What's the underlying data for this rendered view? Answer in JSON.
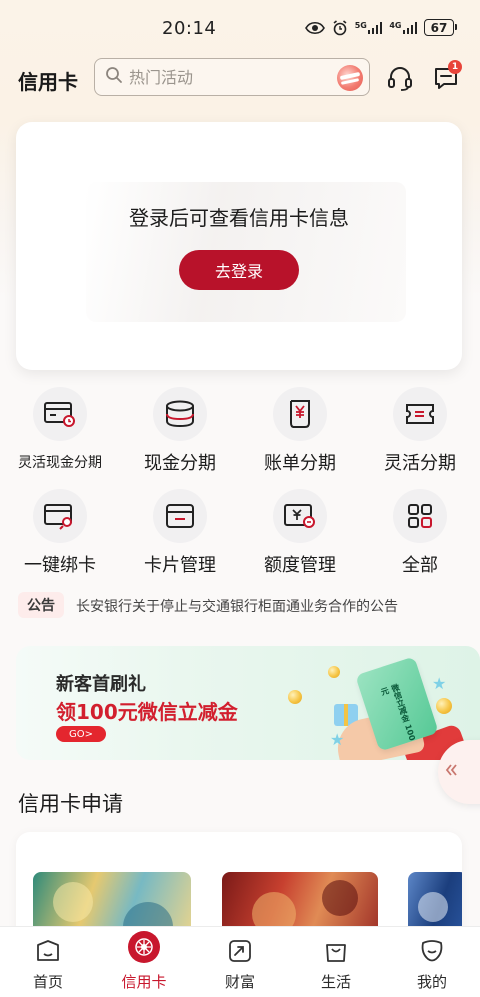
{
  "status_bar": {
    "time": "20:14",
    "net_5g": "5G",
    "net_4g": "4G",
    "battery": "67"
  },
  "header": {
    "title": "信用卡",
    "search_placeholder": "热门活动",
    "message_badge": "1"
  },
  "login_card": {
    "prompt": "登录后可查看信用卡信息",
    "button_label": "去登录"
  },
  "quick_actions": [
    {
      "label": "灵活现金分期",
      "icon": "card-clock-icon"
    },
    {
      "label": "现金分期",
      "icon": "coin-stack-icon"
    },
    {
      "label": "账单分期",
      "icon": "yuan-scroll-icon"
    },
    {
      "label": "灵活分期",
      "icon": "ticket-icon"
    },
    {
      "label": "一键绑卡",
      "icon": "card-link-icon"
    },
    {
      "label": "卡片管理",
      "icon": "wallet-icon"
    },
    {
      "label": "额度管理",
      "icon": "yuan-card-icon"
    },
    {
      "label": "全部",
      "icon": "grid-icon"
    }
  ],
  "notice": {
    "tag": "公告",
    "text": "长安银行关于停止与交通银行柜面通业务合作的公告"
  },
  "promo": {
    "title": "新客首刷礼",
    "subtitle": "领100元微信立减金",
    "go_label": "GO>",
    "ticket_text": "微信立减金 100元"
  },
  "section": {
    "title": "信用卡申请"
  },
  "tab_bar": {
    "active_index": 1,
    "accent_color": "#c8172d",
    "tabs": [
      {
        "label": "首页",
        "icon": "home-icon"
      },
      {
        "label": "信用卡",
        "icon": "credit-card-tab-icon"
      },
      {
        "label": "财富",
        "icon": "trend-icon"
      },
      {
        "label": "生活",
        "icon": "shopping-bag-icon"
      },
      {
        "label": "我的",
        "icon": "profile-icon"
      }
    ]
  },
  "colors": {
    "primary": "#b8122a",
    "notice_bg": "#fdeceb",
    "promo_red": "#d21f2e"
  }
}
